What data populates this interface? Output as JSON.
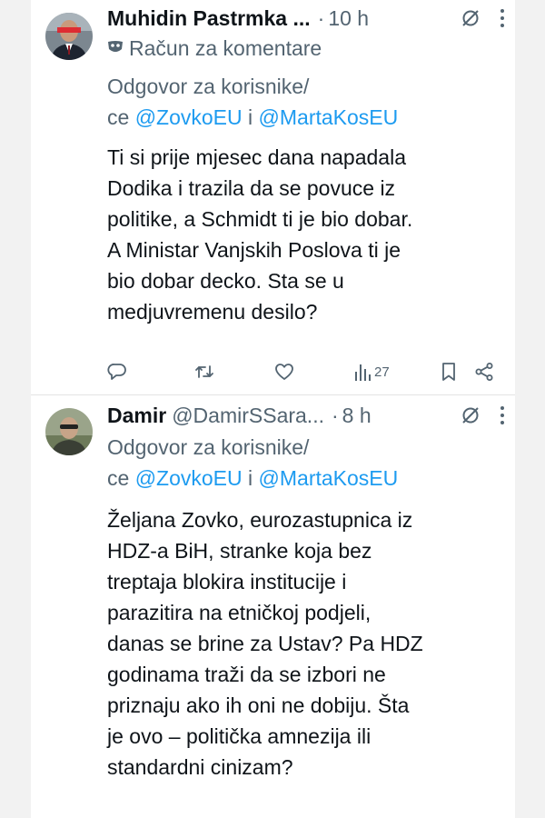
{
  "tweets": [
    {
      "author_name": "Muhidin Pastrmka ...",
      "handle": "",
      "time": "10 h",
      "dot": "·",
      "badge_label": "Račun za komentare",
      "reply_line1": "Odgovor za korisnike/",
      "reply_ce": "ce ",
      "mention1": "@ZovkoEU",
      "reply_and": " i ",
      "mention2": "@MartaKosEU",
      "text_lines": [
        "Ti si prije mjesec dana napadala",
        "Dodika i trazila da se povuce iz",
        "politike, a Schmidt ti je bio dobar.",
        "A Ministar Vanjskih Poslova ti je",
        "bio dobar decko. Sta se u",
        "medjuvremenu desilo?"
      ],
      "views": "27",
      "icons": [
        "grok-icon",
        "more-icon",
        "reply-icon",
        "retweet-icon",
        "like-icon",
        "views-icon",
        "bookmark-icon",
        "share-icon"
      ]
    },
    {
      "author_name": "Damir",
      "handle": "@DamirSSara...",
      "time": "8 h",
      "dot": "·",
      "reply_line1": "Odgovor za korisnike/",
      "reply_ce": "ce ",
      "mention1": "@ZovkoEU",
      "reply_and": " i ",
      "mention2": "@MartaKosEU",
      "text_lines": [
        "Željana Zovko, eurozastupnica iz",
        "HDZ-a BiH, stranke koja bez",
        "treptaja blokira institucije i",
        "parazitira na etničkoj podjeli,",
        "danas se brine za Ustav? Pa HDZ",
        "godinama traži da se izbori ne",
        "priznaju ako ih oni ne dobiju. Šta",
        "je ovo – politička amnezija ili",
        "standardni cinizam?"
      ]
    }
  ],
  "colors": {
    "link": "#1d9bf0",
    "muted": "#536471",
    "text": "#0f1419"
  }
}
